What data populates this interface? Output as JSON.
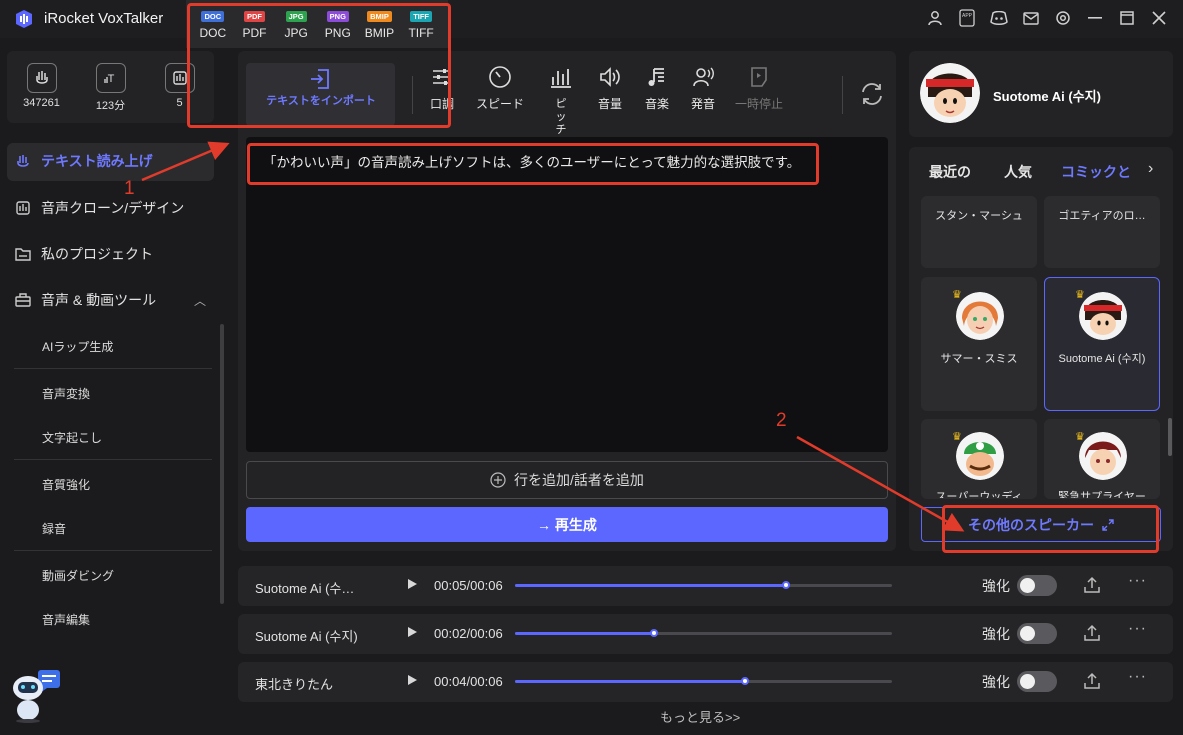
{
  "app": {
    "title": "iRocket VoxTalker"
  },
  "formats": [
    {
      "badge": "DOC",
      "label": "DOC",
      "color": "#3f6fd8"
    },
    {
      "badge": "PDF",
      "label": "PDF",
      "color": "#e04545"
    },
    {
      "badge": "JPG",
      "label": "JPG",
      "color": "#2ea34f"
    },
    {
      "badge": "PNG",
      "label": "PNG",
      "color": "#8c4bd8"
    },
    {
      "badge": "BMIP",
      "label": "BMIP",
      "color": "#f08a1c"
    },
    {
      "badge": "TIFF",
      "label": "TIFF",
      "color": "#1aa6b3"
    }
  ],
  "stats": [
    {
      "icon": "voice-count-icon",
      "value": "347261"
    },
    {
      "icon": "text-minutes-icon",
      "value": "123分"
    },
    {
      "icon": "clone-count-icon",
      "value": "5"
    }
  ],
  "nav": {
    "tts": "テキスト読み上げ",
    "clone": "音声クローン/デザイン",
    "projects": "私のプロジェクト",
    "tools": "音声 & 動画ツール",
    "sub": [
      "AIラップ生成",
      "音声変換",
      "文字起こし",
      "音質強化",
      "録音",
      "動画ダビング",
      "音声編集"
    ]
  },
  "toolbar": {
    "import": "テキストをインポート",
    "tone": "口調",
    "speed": "スピード",
    "pitch": "ピッチ",
    "volume": "音量",
    "music": "音楽",
    "pronounce": "発音",
    "pause": "一時停止"
  },
  "editor": {
    "text": "「かわいい声」の音声読み上げソフトは、多くのユーザーにとって魅力的な選択肢です。"
  },
  "add_line": "行を追加/話者を追加",
  "regenerate": "→ 再生成",
  "profile": {
    "name": "Suotome Ai (수지)"
  },
  "voice_tabs": [
    "最近の",
    "人気",
    "コミックと"
  ],
  "voices": [
    {
      "name": "スタン・マーシュ"
    },
    {
      "name": "ゴエティアのロ…"
    },
    {
      "name": "サマー・スミス"
    },
    {
      "name": "Suotome Ai (수지)"
    },
    {
      "name": "スーパーウッディ"
    },
    {
      "name": "緊急サプライヤー"
    }
  ],
  "more_speakers": "その他のスピーカー",
  "history": [
    {
      "speaker": "Suotome Ai (수…",
      "time": "00:05/00:06",
      "progress": 0.72,
      "enhance": "強化"
    },
    {
      "speaker": "Suotome Ai (수지)",
      "time": "00:02/00:06",
      "progress": 0.37,
      "enhance": "強化"
    },
    {
      "speaker": "東北きりたん",
      "time": "00:04/00:06",
      "progress": 0.61,
      "enhance": "強化"
    }
  ],
  "more": "もっと見る>>",
  "annotations": {
    "one": "1",
    "two": "2"
  },
  "colors": {
    "accent": "#5b67ff",
    "annotation": "#e13b2b",
    "background": "#1b1b1d"
  }
}
